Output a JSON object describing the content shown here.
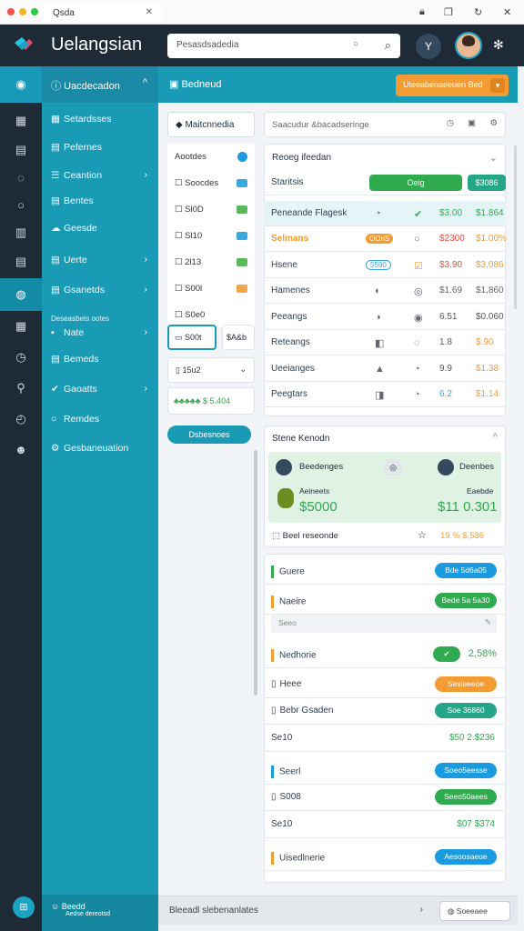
{
  "titlebar": {
    "tab_label": "Qsda",
    "icons": [
      "lock-icon",
      "copy-icon",
      "refresh-icon",
      "close-icon"
    ]
  },
  "header": {
    "brand": "Uelangsian",
    "search_placeholder": "Pesasdsadedia",
    "button_label": "Y"
  },
  "sidebar": {
    "header_label": "Uacdecadon",
    "items": [
      {
        "label": "Setardsses",
        "icon": "grid-icon",
        "chevron": false
      },
      {
        "label": "Pefernes",
        "icon": "doc-icon",
        "chevron": false
      },
      {
        "label": "Ceantion",
        "icon": "list-icon",
        "chevron": true
      },
      {
        "label": "Bentes",
        "icon": "doc-icon",
        "chevron": false
      },
      {
        "label": "Geesde",
        "icon": "cloud-icon",
        "chevron": false
      },
      {
        "label": "Uerte",
        "icon": "doc-icon",
        "chevron": true
      },
      {
        "label": "Gsanetds",
        "icon": "doc-icon",
        "chevron": true
      },
      {
        "label": "Nate",
        "icon": "bullet-icon",
        "chevron": true
      },
      {
        "label": "Bemeds",
        "icon": "doc-icon",
        "chevron": false
      },
      {
        "label": "Gaoatts",
        "icon": "check-icon",
        "chevron": true
      },
      {
        "label": "Remdes",
        "icon": "circle-icon",
        "chevron": false
      },
      {
        "label": "Gesbaneuation",
        "icon": "gear-icon",
        "chevron": false
      }
    ],
    "section_label": "Deseasbets ootes",
    "footer_label": "Beedd",
    "footer_sub": "Aedse dereotsd"
  },
  "topbar": {
    "title": "Bedneud",
    "button_label": "Uteeabenaeeuen Bed"
  },
  "left_panel": {
    "tab_label": "Maitcnnedia",
    "rows": [
      {
        "label": "Aootdes",
        "color": "#1a9be0",
        "kind": "radio"
      },
      {
        "label": "Soocdes",
        "color": "#3aa9dd"
      },
      {
        "label": "Sl0D",
        "color": "#5cb85c"
      },
      {
        "label": "Sl10",
        "color": "#3aa9dd"
      },
      {
        "label": "2l13",
        "color": "#5cb85c"
      },
      {
        "label": "S00l",
        "color": "#f0a94a"
      },
      {
        "label": "S0e0",
        "color": ""
      }
    ],
    "field_a": "S00t",
    "field_b": "$A&b",
    "select_value": "15u2",
    "rating": "$ 5.404",
    "button_label": "Dsbesnoes"
  },
  "filter": {
    "placeholder": "Saacudur &bacadseringe"
  },
  "report": {
    "title": "Reoeg ifeedan",
    "rows": [
      {
        "label": "Staritsis",
        "p1": "Oeig",
        "p2": "$3086",
        "p1c": "#2faa4f",
        "p2c": "#26a688"
      },
      {
        "label": "Peneande Flagesk",
        "c2": "◔",
        "c3": "✔",
        "c4": "$3.00",
        "c5": "$1.864",
        "c4c": "#2faa4f",
        "c5c": "#2faa4f"
      },
      {
        "label": "Selmans",
        "c2": "OOnS",
        "c3": "○",
        "c4": "$2300",
        "c5": "$1.00%",
        "c4c": "#e74c3c",
        "c5c": "#f39c33"
      },
      {
        "label": "Hsene",
        "c2": "5590",
        "c3": "☑",
        "c4": "$3.90",
        "c5": "$3,086",
        "c4c": "#e74c3c",
        "c5c": "#f39c33"
      },
      {
        "label": "Hamenes",
        "c2": "◐",
        "c3": "◎",
        "c4": "$1.69",
        "c5": "$1,860",
        "c4c": "#666",
        "c5c": "#666"
      },
      {
        "label": "Peeangs",
        "c2": "◑",
        "c3": "◉",
        "c4": "6.51",
        "c5": "$0.060",
        "c4c": "#555",
        "c5c": "#555"
      },
      {
        "label": "Reteangs",
        "c2": "◧",
        "c3": "◌",
        "c4": "1.8",
        "c5": "$.90",
        "c4c": "#555",
        "c5c": "#f39c33"
      },
      {
        "label": "Ueeianges",
        "c2": "▲",
        "c3": "◔",
        "c4": "9.9",
        "c5": "$1.38",
        "c4c": "#555",
        "c5c": "#f39c33"
      },
      {
        "label": "Peegtars",
        "c2": "◨",
        "c3": "◔",
        "c4": "6.2",
        "c5": "$1.14",
        "c4c": "#3aa9dd",
        "c5c": "#f39c33"
      }
    ]
  },
  "summary": {
    "title": "Stene Kenodn",
    "left_label": "Beedenges",
    "right_label": "Deenbes",
    "left_sub": "Aeineets",
    "right_sub": "Eaebde",
    "left_value": "$5000",
    "right_value": "$11 0.301",
    "footer_left": "Beel reseonde",
    "footer_right": "19.%  $,536"
  },
  "list": [
    {
      "label": "Guere",
      "bar": "#2faa4f",
      "pill": "Bde 5d6a05",
      "pillc": "#1a9be0"
    },
    {
      "label": "Naeire",
      "bar": "#f39c33",
      "pill": "Bede 5a 5a30",
      "pillc": "#2faa4f",
      "sub": "Seeo"
    },
    {
      "label": "Nedhorie",
      "bar": "#f39c33",
      "pill": "2,58%",
      "pillc": "#2faa4f",
      "check": true
    },
    {
      "label": "Heee",
      "bar": "",
      "pill": "Sesieeeoe",
      "pillc": "#f39c33"
    },
    {
      "label": "Bebr Gsaden",
      "bar": "",
      "pill": "Soe 36860",
      "pillc": "#26a688"
    },
    {
      "label": "Se10",
      "bar": "",
      "pill": "$50 2.$236",
      "pillc": "",
      "green": true
    },
    {
      "label": "Seerl",
      "bar": "#1a9be0",
      "pill": "Soeo5eesse",
      "pillc": "#1a9be0"
    },
    {
      "label": "S008",
      "bar": "",
      "pill": "Seeo50aees",
      "pillc": "#2faa4f"
    },
    {
      "label": "Se10",
      "bar": "",
      "pill": "$07 $374",
      "pillc": "",
      "green": true
    },
    {
      "label": "Uisedlnerie",
      "bar": "#f39c33",
      "pill": "Aesoosaeoe",
      "pillc": "#1a9be0"
    }
  ],
  "status": {
    "label": "Bleeadl slebenanlates",
    "box_label": "Soeeaee"
  }
}
